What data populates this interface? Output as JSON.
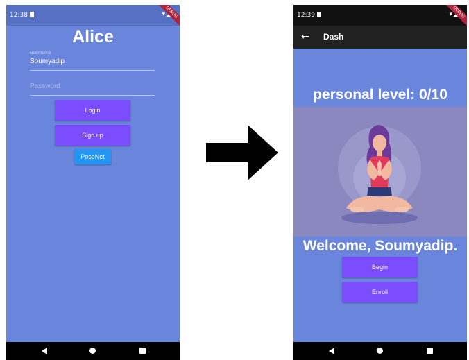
{
  "left_screen": {
    "status": {
      "time": "12:38",
      "icons": "▾◢▮"
    },
    "title": "Alice",
    "username": {
      "label": "Username",
      "value": "Soumyadip"
    },
    "password": {
      "placeholder": "Password"
    },
    "buttons": {
      "login": "Login",
      "signup": "Sign up",
      "posenet": "PoseNet"
    }
  },
  "right_screen": {
    "status": {
      "time": "12:39",
      "icons": "▾◢▮"
    },
    "appbar": {
      "back": "←",
      "title": "Dash"
    },
    "level_text": "personal level: 0/10",
    "welcome_text": "Welcome, Soumyadip.",
    "buttons": {
      "begin": "Begin",
      "enroll": "Enroll"
    }
  },
  "debug_banner": "DEBUG",
  "colors": {
    "background": "#6a86dc",
    "button_purple": "#7c4dff",
    "button_blue": "#2196f3",
    "appbar": "#212121"
  }
}
